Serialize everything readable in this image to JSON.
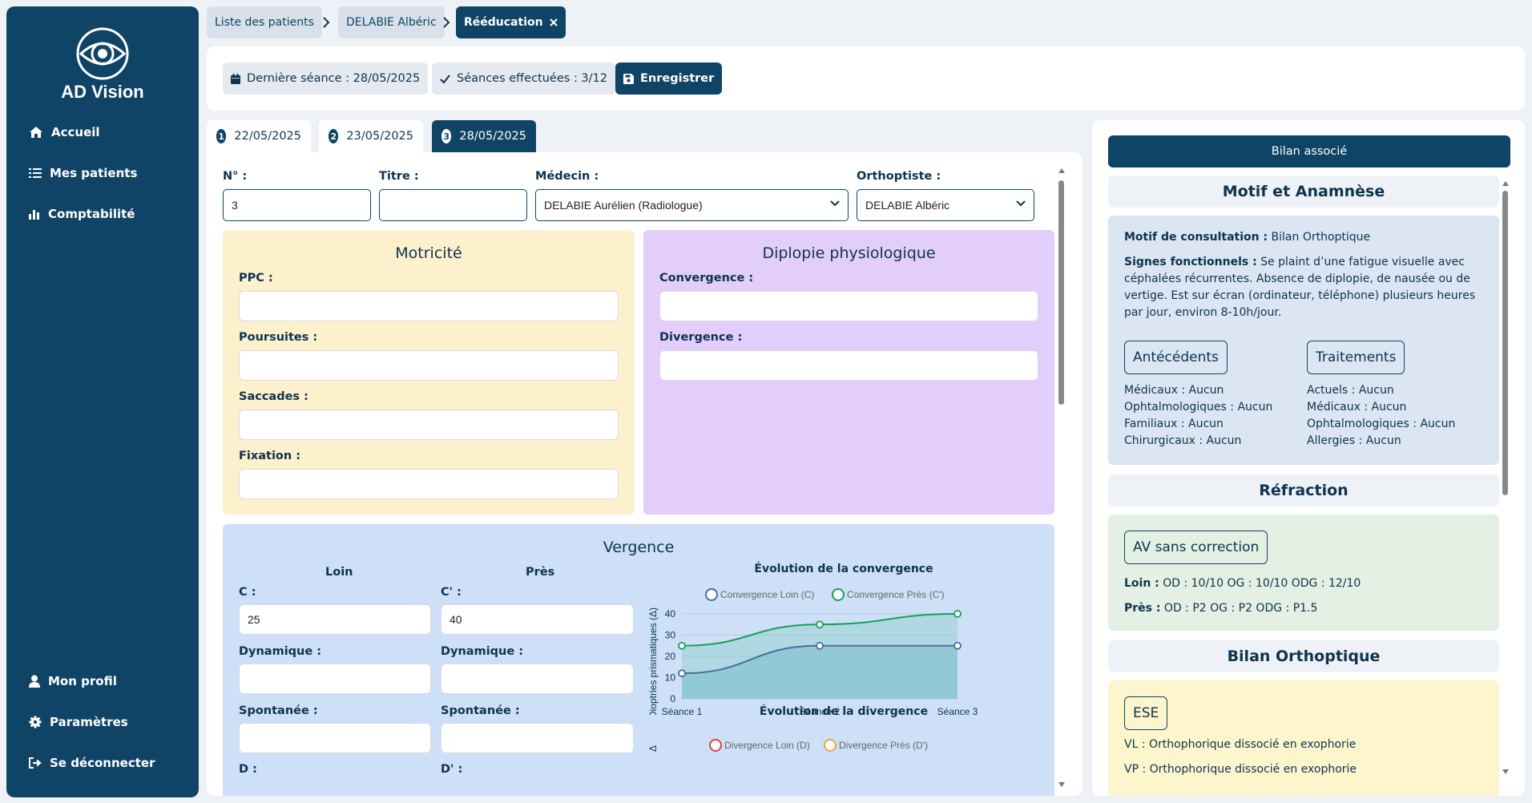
{
  "app": {
    "name": "AD Vision"
  },
  "sidebar": {
    "items": [
      {
        "label": "Accueil",
        "icon": "home-icon"
      },
      {
        "label": "Mes patients",
        "icon": "list-icon"
      },
      {
        "label": "Comptabilité",
        "icon": "bar-chart-icon"
      }
    ],
    "bottom_items": [
      {
        "label": "Mon profil",
        "icon": "user-icon"
      },
      {
        "label": "Paramètres",
        "icon": "gear-icon"
      },
      {
        "label": "Se déconnecter",
        "icon": "logout-icon"
      }
    ]
  },
  "breadcrumb": [
    "Liste des patients",
    "DELABIE Albéric",
    "Rééducation"
  ],
  "toolbar": {
    "last_session": "Dernière séance : 28/05/2025",
    "sessions_done": "Séances effectuées : 3/12",
    "save_label": "Enregistrer"
  },
  "tabs": [
    {
      "num": "1",
      "label": "22/05/2025"
    },
    {
      "num": "2",
      "label": "23/05/2025"
    },
    {
      "num": "3",
      "label": "28/05/2025",
      "active": true
    }
  ],
  "form": {
    "no_label": "N° :",
    "no_value": "3",
    "titre_label": "Titre :",
    "titre_value": "",
    "medecin_label": "Médecin :",
    "medecin_value": "DELABIE Aurélien (Radiologue)",
    "ortho_label": "Orthoptiste :",
    "ortho_value": "DELABIE Albéric"
  },
  "motricite": {
    "title": "Motricité",
    "fields": [
      "PPC :",
      "Poursuites :",
      "Saccades :",
      "Fixation :"
    ]
  },
  "diplopie": {
    "title": "Diplopie physiologique",
    "fields": [
      "Convergence :",
      "Divergence :"
    ]
  },
  "vergence": {
    "title": "Vergence",
    "loin": "Loin",
    "pres": "Près",
    "c_label": "C :",
    "c_value": "25",
    "cp_label": "C' :",
    "cp_value": "40",
    "dyn_label": "Dynamique :",
    "spont_label": "Spontanée :",
    "d_label": "D :",
    "dp_label": "D' :"
  },
  "chart_data": [
    {
      "type": "line",
      "title": "Évolution de la convergence",
      "ylabel": "Dioptries prismatiques (Δ)",
      "categories": [
        "Séance 1",
        "Séance 2",
        "Séance 3"
      ],
      "ylim": [
        0,
        40
      ],
      "yticks": [
        "0",
        "10",
        "20",
        "30",
        "40"
      ],
      "series": [
        {
          "name": "Convergence Loin (C)",
          "values": [
            12,
            25,
            25
          ],
          "color": "#4a6d9c"
        },
        {
          "name": "Convergence Près (C')",
          "values": [
            25,
            35,
            40
          ],
          "color": "#17a058"
        }
      ]
    },
    {
      "type": "line",
      "title": "Évolution de la divergence",
      "series": [
        {
          "name": "Divergence Loin (D)",
          "color": "#d94545"
        },
        {
          "name": "Divergence Près (D')",
          "color": "#f0a040"
        }
      ]
    }
  ],
  "right_panel": {
    "bilan_btn": "Bilan associé",
    "motif_title": "Motif et Anamnèse",
    "motif_label": "Motif de consultation :",
    "motif_value": "Bilan Orthoptique",
    "signes_label": "Signes fonctionnels :",
    "signes_value": "Se plaint d’une fatigue visuelle avec céphalées récurrentes. Absence de diplopie, de nausée ou de vertige. Est sur écran (ordinateur, téléphone) plusieurs heures par jour, environ 8-10h/jour.",
    "antecedents_title": "Antécédents",
    "antecedents": [
      {
        "label": "Médicaux :",
        "value": "Aucun"
      },
      {
        "label": "Ophtalmologiques :",
        "value": "Aucun"
      },
      {
        "label": "Familiaux :",
        "value": "Aucun"
      },
      {
        "label": "Chirurgicaux :",
        "value": "Aucun"
      }
    ],
    "traitements_title": "Traitements",
    "traitements": [
      {
        "label": "Actuels :",
        "value": "Aucun"
      },
      {
        "label": "Médicaux :",
        "value": "Aucun"
      },
      {
        "label": "Ophtalmologiques :",
        "value": "Aucun"
      },
      {
        "label": "Allergies :",
        "value": "Aucun"
      }
    ],
    "refraction_title": "Réfraction",
    "av_title": "AV sans correction",
    "loin_label": "Loin :",
    "loin_value": "OD : 10/10 OG : 10/10 ODG : 12/10",
    "pres_label": "Près :",
    "pres_value": "OD : P2 OG : P2 ODG : P1.5",
    "bilan_title": "Bilan Orthoptique",
    "ese_title": "ESE",
    "vl_label": "VL :",
    "vl_value": "Orthophorique dissocié en exophorie",
    "vp_label": "VP :",
    "vp_value": "Orthophorique dissocié en exophorie"
  }
}
